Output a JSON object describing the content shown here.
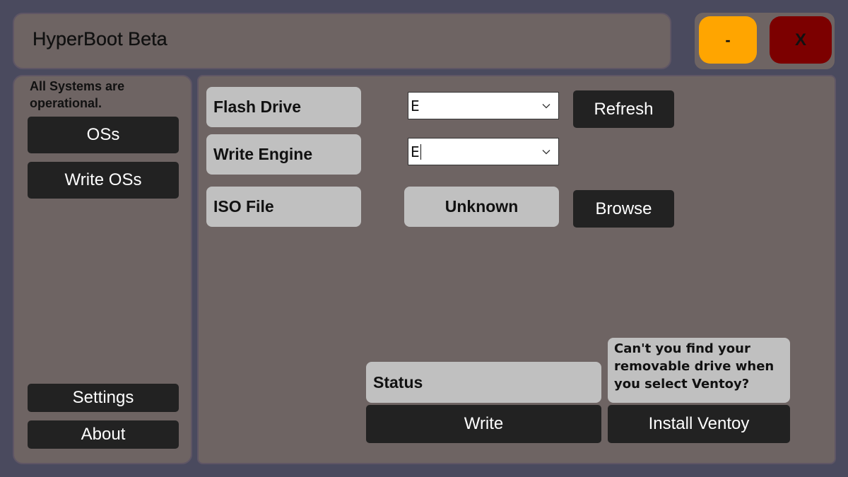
{
  "app": {
    "title": "HyperBoot Beta"
  },
  "window_controls": {
    "minimize_label": "-",
    "close_label": "X"
  },
  "sidebar": {
    "status_message": "All Systems are operational.",
    "nav_items": [
      "OSs",
      "Write OSs"
    ],
    "bottom_items": [
      "Settings",
      "About"
    ]
  },
  "main": {
    "flash_drive": {
      "label": "Flash Drive",
      "value": "E",
      "refresh_label": "Refresh"
    },
    "write_engine": {
      "label": "Write Engine",
      "value": "E"
    },
    "iso_file": {
      "label": "ISO File",
      "value": "Unknown",
      "browse_label": "Browse"
    },
    "status_label": "Status",
    "write_label": "Write",
    "ventoy_hint": "Can't you find your removable drive when you select Ventoy?",
    "install_ventoy_label": "Install Ventoy"
  },
  "colors": {
    "background": "#4a4a5e",
    "panel": "#6e6463",
    "minimize": "#ffa500",
    "close": "#7c0000",
    "dark_button": "#222222",
    "label_bg": "#c0c0c0"
  }
}
